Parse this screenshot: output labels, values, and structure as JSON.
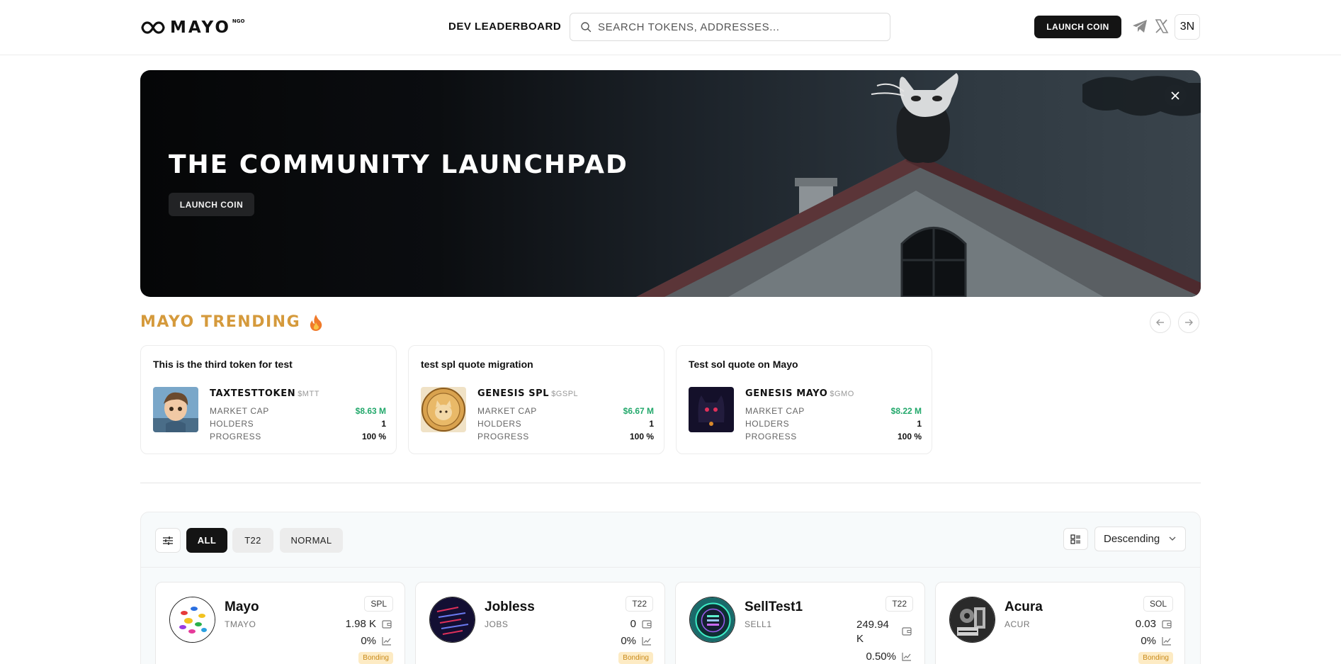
{
  "header": {
    "logo_text": "MAYO",
    "logo_sup": "NGO",
    "nav_link": "DEV LEADERBOARD",
    "search_placeholder": "SEARCH TOKENS, ADDRESSES...",
    "launch_label": "LAUNCH COIN",
    "account_label": "3N",
    "icons": [
      "telegram-icon",
      "x-icon"
    ]
  },
  "hero": {
    "title": "THE COMMUNITY LAUNCHPAD",
    "button_label": "LAUNCH COIN"
  },
  "trending": {
    "title": "MAYO TRENDING",
    "cards": [
      {
        "description": "This is the third token for test",
        "name": "TAXTESTTOKEN",
        "ticker": "$MTT",
        "market_cap_label": "MARKET CAP",
        "market_cap": "$8.63 M",
        "holders_label": "HOLDERS",
        "holders": "1",
        "progress_label": "PROGRESS",
        "progress": "100 %"
      },
      {
        "description": "test spl quote migration",
        "name": "GENESIS SPL",
        "ticker": "$GSPL",
        "market_cap_label": "MARKET CAP",
        "market_cap": "$6.67 M",
        "holders_label": "HOLDERS",
        "holders": "1",
        "progress_label": "PROGRESS",
        "progress": "100 %"
      },
      {
        "description": "Test sol quote on Mayo",
        "name": "GENESIS MAYO",
        "ticker": "$GMO",
        "market_cap_label": "MARKET CAP",
        "market_cap": "$8.22 M",
        "holders_label": "HOLDERS",
        "holders": "1",
        "progress_label": "PROGRESS",
        "progress": "100 %"
      }
    ]
  },
  "list": {
    "filters": [
      "ALL",
      "T22",
      "NORMAL"
    ],
    "active_filter": "ALL",
    "sort": "Descending",
    "tokens": [
      {
        "name": "Mayo",
        "ticker": "TMAYO",
        "chain": "SPL",
        "value": "1.98 K",
        "change": "0%",
        "badge": "Bonding"
      },
      {
        "name": "Jobless",
        "ticker": "JOBS",
        "chain": "T22",
        "value": "0",
        "change": "0%",
        "badge": "Bonding"
      },
      {
        "name": "SellTest1",
        "ticker": "SELL1",
        "chain": "T22",
        "value_line1": "249.94",
        "value_line2": "K",
        "change": "0.50%"
      },
      {
        "name": "Acura",
        "ticker": "ACUR",
        "chain": "SOL",
        "value": "0.03",
        "change": "0%",
        "badge": "Bonding"
      }
    ]
  }
}
